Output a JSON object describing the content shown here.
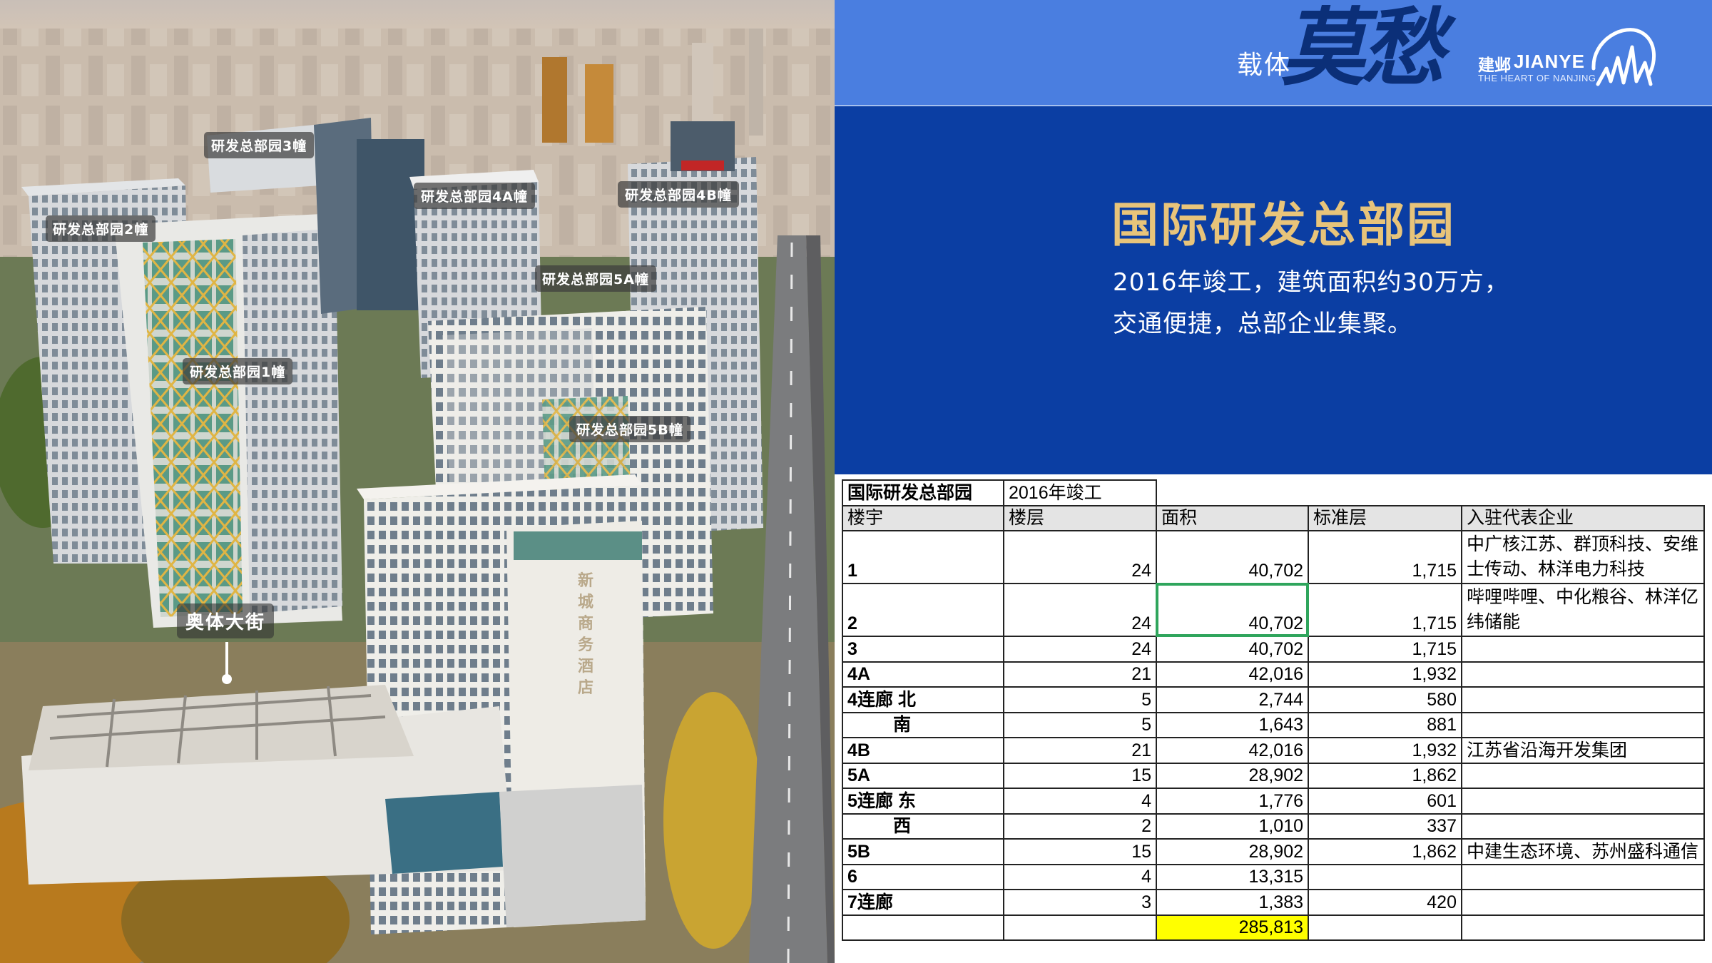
{
  "header": {
    "carrier_text": "载体",
    "calligraphy_text": "莫愁",
    "brand": {
      "cn_name": "建邺",
      "en_name": "JIANYE",
      "tagline": "THE HEART OF NANJING",
      "logo_icon": "jianye-mountain-logo-icon"
    },
    "colors": {
      "topbar": "#4a7ee0",
      "panel": "#0b3ea3",
      "title": "#e8c47a"
    }
  },
  "hero": {
    "title": "国际研发总部园",
    "description_lines": [
      "2016年竣工，建筑面积约30万方，",
      "交通便捷，总部企业集聚。"
    ]
  },
  "photo": {
    "labels": [
      "研发总部园3幢",
      "研发总部园4A幢",
      "研发总部园4B幢",
      "研发总部园2幢",
      "研发总部园5A幢",
      "研发总部园1幢",
      "研发总部园5B幢"
    ],
    "street": "奥体大街",
    "hotel_sign": "新城商务酒店"
  },
  "table": {
    "title_cell": "国际研发总部园",
    "year_cell": "2016年竣工",
    "headers": [
      "楼宇",
      "楼层",
      "面积",
      "标准层",
      "入驻代表企业"
    ],
    "rows": [
      {
        "building": "1",
        "floors": "24",
        "area": "40,702",
        "std": "1,715",
        "companies": "中广核江苏、群顶科技、安维士传动、林洋电力科技"
      },
      {
        "building": "2",
        "floors": "24",
        "area": "40,702",
        "std": "1,715",
        "companies": "哔哩哔哩、中化粮谷、林洋亿纬储能"
      },
      {
        "building": "3",
        "floors": "24",
        "area": "40,702",
        "std": "1,715",
        "companies": ""
      },
      {
        "building": "4A",
        "floors": "21",
        "area": "42,016",
        "std": "1,932",
        "companies": ""
      },
      {
        "building": "4连廊 北",
        "floors": "5",
        "area": "2,744",
        "std": "580",
        "companies": ""
      },
      {
        "building": "南",
        "floors": "5",
        "area": "1,643",
        "std": "881",
        "companies": ""
      },
      {
        "building": "4B",
        "floors": "21",
        "area": "42,016",
        "std": "1,932",
        "companies": "江苏省沿海开发集团"
      },
      {
        "building": "5A",
        "floors": "15",
        "area": "28,902",
        "std": "1,862",
        "companies": ""
      },
      {
        "building": "5连廊 东",
        "floors": "4",
        "area": "1,776",
        "std": "601",
        "companies": ""
      },
      {
        "building": "西",
        "floors": "2",
        "area": "1,010",
        "std": "337",
        "companies": ""
      },
      {
        "building": "5B",
        "floors": "15",
        "area": "28,902",
        "std": "1,862",
        "companies": "中建生态环境、苏州盛科通信"
      },
      {
        "building": "6",
        "floors": "4",
        "area": "13,315",
        "std": "",
        "companies": ""
      },
      {
        "building": "7连廊",
        "floors": "3",
        "area": "1,383",
        "std": "420",
        "companies": ""
      }
    ],
    "total_area": "285,813",
    "colors": {
      "selected_border": "#2fa55c",
      "total_highlight": "#ffff00",
      "header_bg": "#e4e4e4"
    }
  }
}
